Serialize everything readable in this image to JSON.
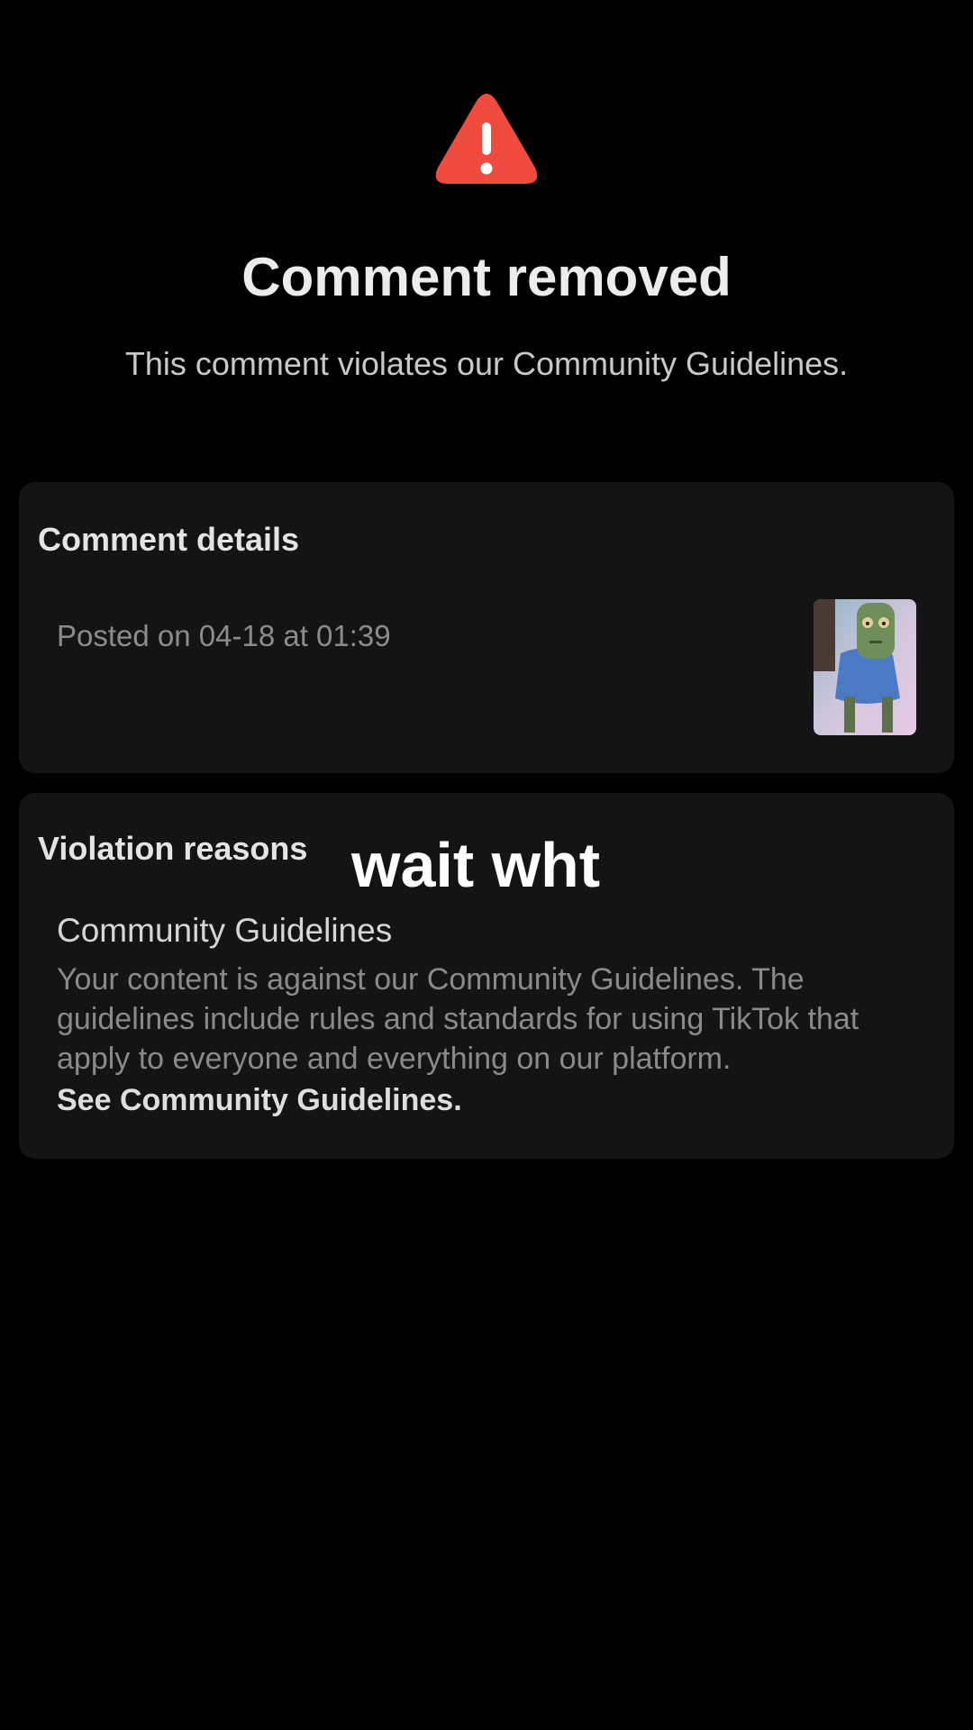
{
  "header": {
    "icon": "warning-triangle-icon",
    "title": "Comment removed",
    "subtitle": "This comment violates our Community Guidelines."
  },
  "comment_details": {
    "heading": "Comment details",
    "posted": "Posted on 04-18 at 01:39",
    "thumbnail": "video-thumbnail"
  },
  "violation": {
    "heading": "Violation reasons",
    "reason_title": "Community Guidelines",
    "reason_text": "Your content is against our Community Guidelines. The guidelines include rules and standards for using TikTok that apply to everyone and everything on our platform.",
    "link_label": "See Community Guidelines."
  },
  "overlay": {
    "caption": "wait wht"
  },
  "colors": {
    "background": "#000000",
    "card": "#141414",
    "warning": "#f04b3f"
  }
}
